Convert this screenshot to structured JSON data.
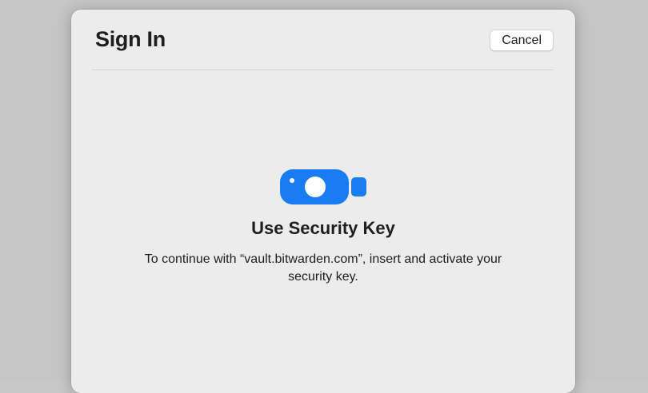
{
  "dialog": {
    "title": "Sign In",
    "cancel_label": "Cancel",
    "icon": "security-key-icon",
    "heading": "Use Security Key",
    "message": "To continue with “vault.bitwarden.com”, insert and activate your security key."
  },
  "colors": {
    "accent": "#1a7cf5",
    "sheet_background": "#ececec"
  }
}
